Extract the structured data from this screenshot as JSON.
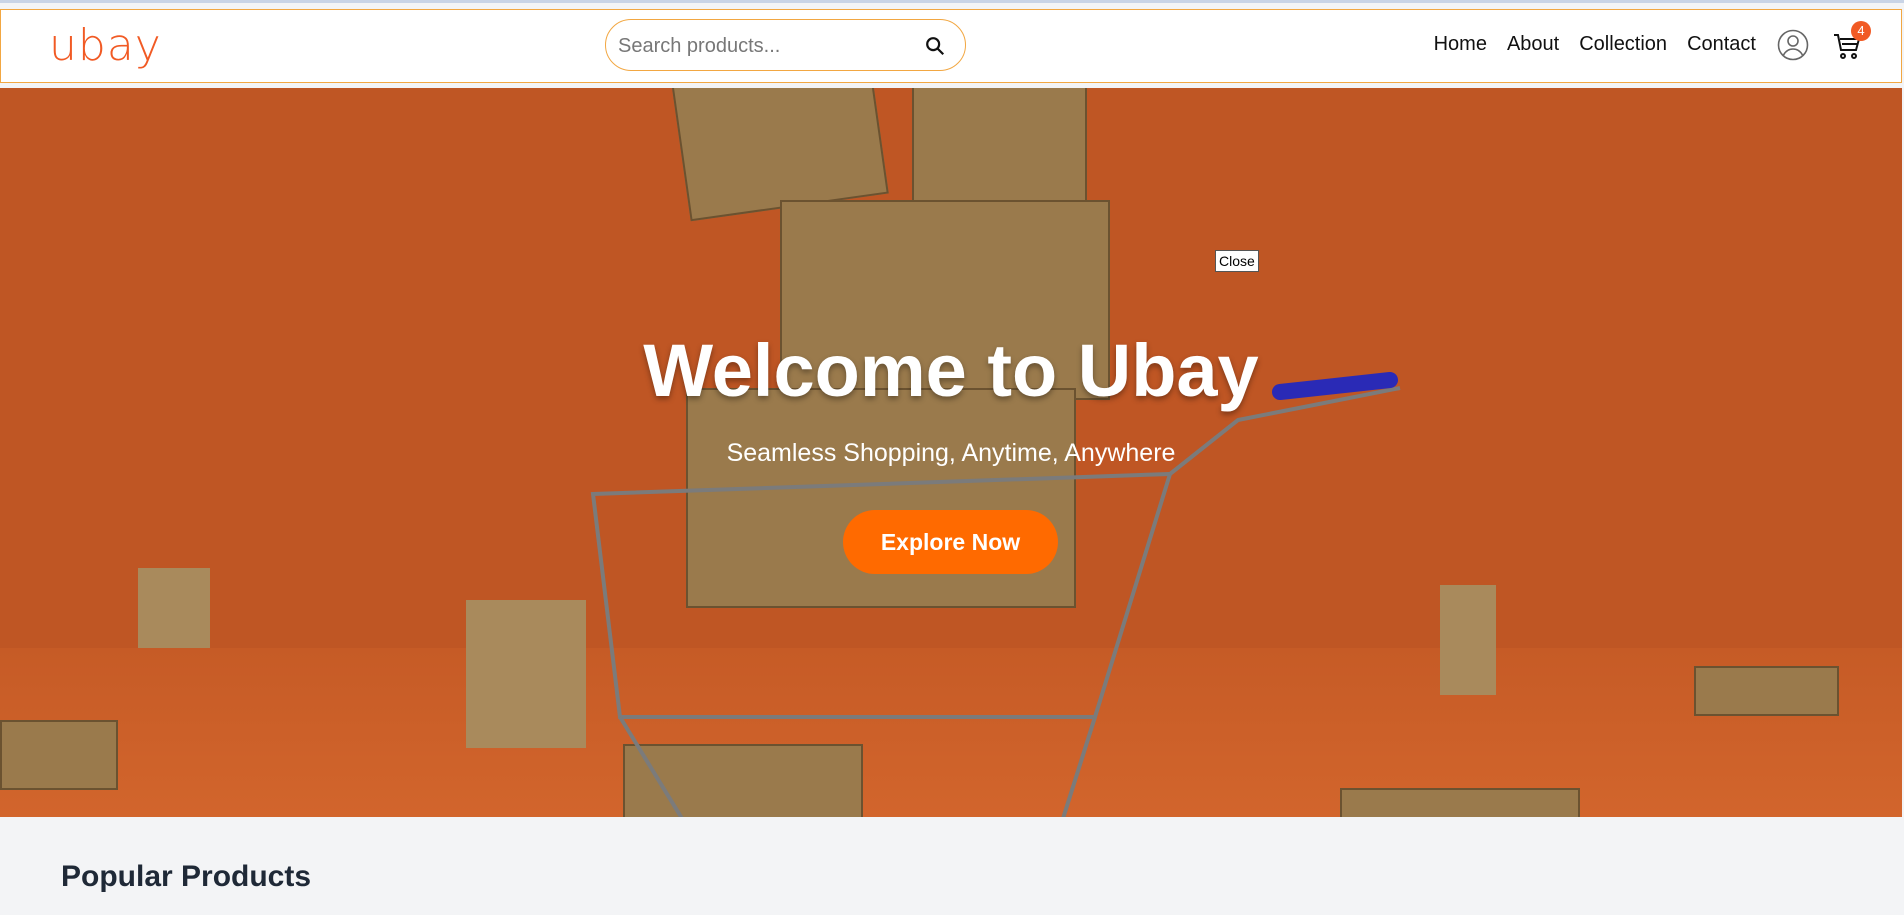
{
  "brand": {
    "logo_text": "ubay",
    "accent": "#f15a24",
    "border_accent": "#f2a742"
  },
  "search": {
    "placeholder": "Search products...",
    "icon": "search-icon"
  },
  "nav": {
    "links": [
      "Home",
      "About",
      "Collection",
      "Contact"
    ]
  },
  "account": {
    "icon": "user-icon"
  },
  "cart": {
    "icon": "cart-icon",
    "badge_count": "4"
  },
  "hero": {
    "title": "Welcome to Ubay",
    "subtitle": "Seamless Shopping, Anytime, Anywhere",
    "cta_label": "Explore Now",
    "close_label": "Close",
    "background_color": "#bf5624",
    "cta_color": "#ff6a00"
  },
  "popular": {
    "title": "Popular Products"
  }
}
